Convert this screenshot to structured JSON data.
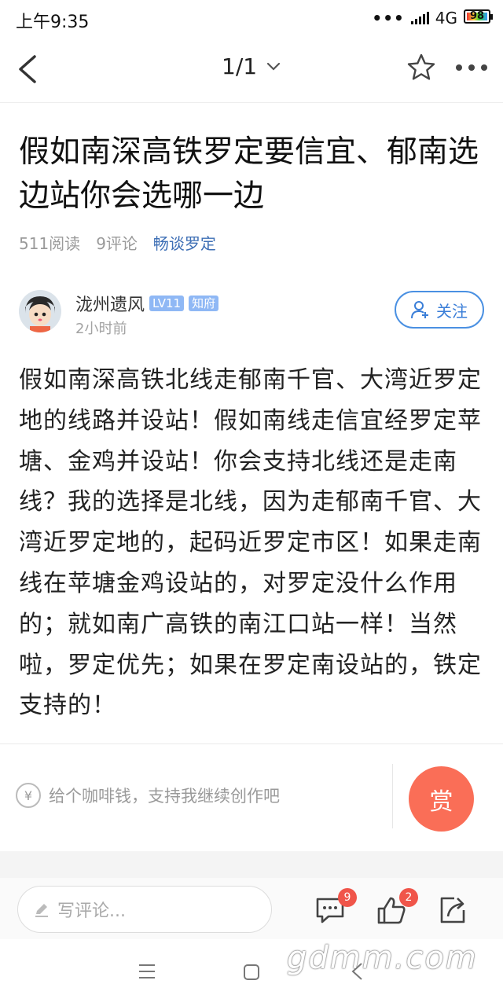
{
  "status_bar": {
    "time": "上午9:35",
    "network": "4G",
    "battery": "98"
  },
  "nav": {
    "page_indicator": "1/1"
  },
  "post": {
    "title": "假如南深高铁罗定要信宜、郁南选边站你会选哪一边",
    "reads": "511阅读",
    "comments": "9评论",
    "forum": "畅谈罗定",
    "author": "泷州遗风",
    "level_badge": "LV11",
    "title_badge": "知府",
    "posted_time": "2小时前",
    "follow_label": "关注",
    "body": "假如南深高铁北线走郁南千官、大湾近罗定地的线路并设站！假如南线走信宜经罗定苹塘、金鸡并设站！你会支持北线还是走南线？我的选择是北线，因为走郁南千官、大湾近罗定地的，起码近罗定市区！如果走南线在苹塘金鸡设站的，对罗定没什么作用的；就如南广高铁的南江口站一样！当然啦，罗定优先；如果在罗定南设站的，铁定支持的！"
  },
  "reward": {
    "tip_text": "给个咖啡钱，支持我继续创作吧",
    "yen_symbol": "¥",
    "button_label": "赏"
  },
  "bottom_bar": {
    "comment_placeholder": "写评论...",
    "comment_count": "9",
    "like_count": "2"
  },
  "watermark": "gdmm.com",
  "colors": {
    "accent": "#4a90e2",
    "reward": "#fa6e57",
    "badge_red": "#f0554a",
    "forum_link": "#3e6fb5"
  }
}
